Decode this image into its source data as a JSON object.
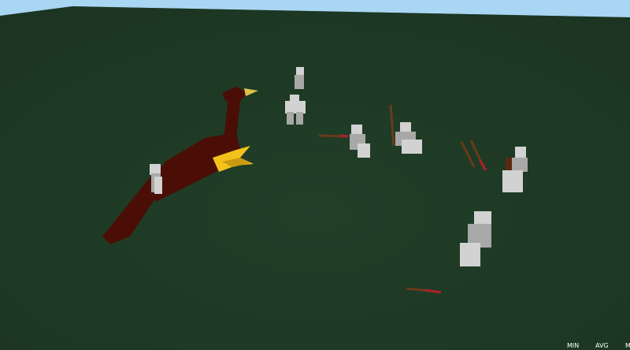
{
  "scene": {
    "sky_color": "#a9d6f2",
    "ground_color": "#1f3a26",
    "ground_edge_color": "#16301d",
    "creature_color": "#4a0e07",
    "creature_beak_color": "#d8c14c",
    "creature_wing_color": "#f2c21b",
    "figure_color": "#d2d2d2",
    "figure_shade_color": "#a8a8a8",
    "backpack_color": "#5a2a12",
    "spear_color": "#6a3a1a",
    "spear_tip_color": "#b0202a"
  },
  "hud": {
    "min_label": "MIN",
    "avg_label": "AVG",
    "max_label": "M"
  }
}
